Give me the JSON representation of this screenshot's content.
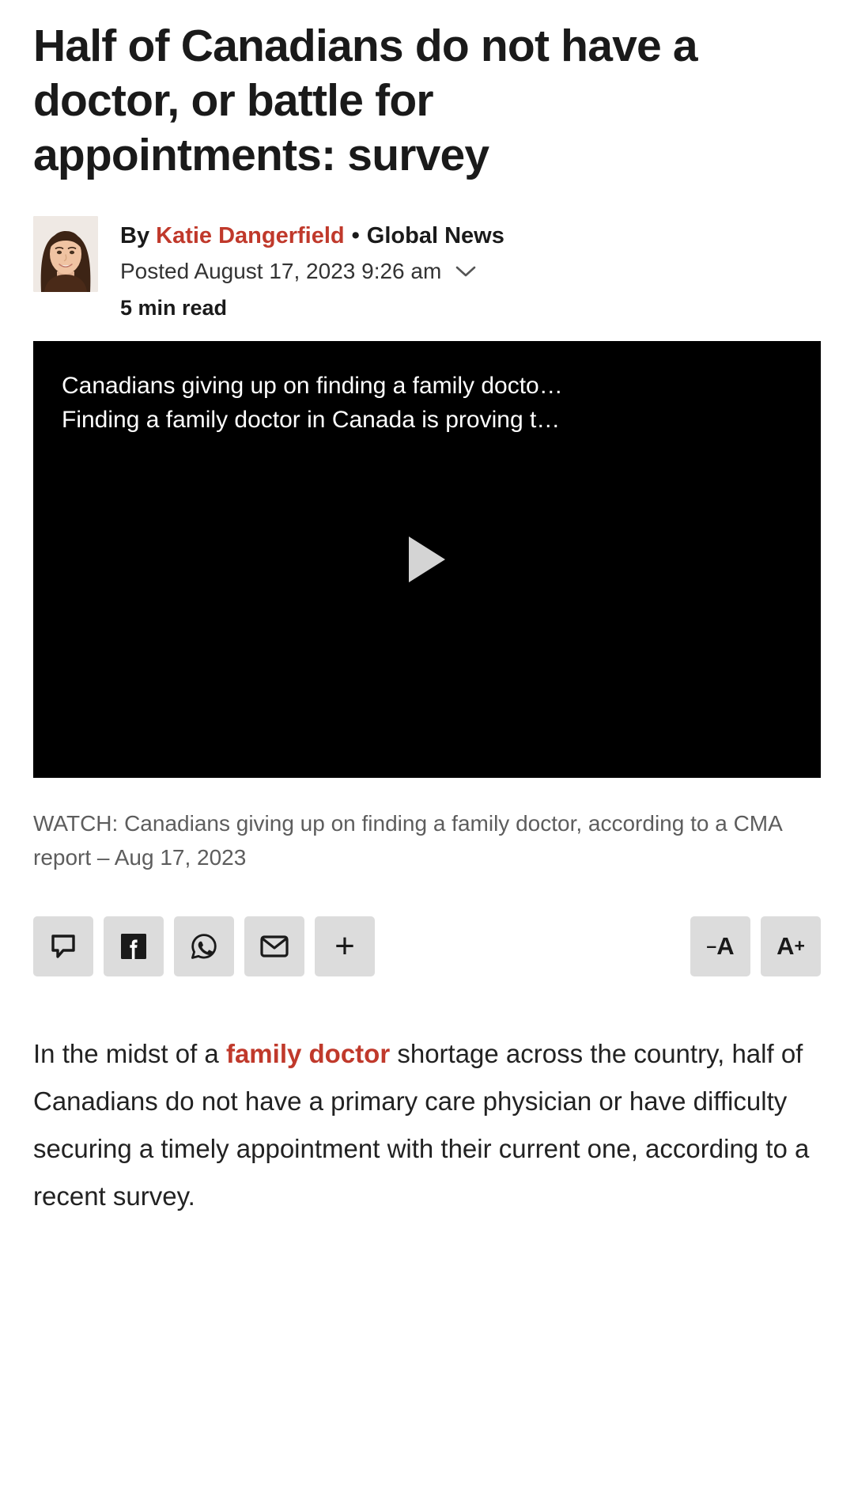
{
  "article": {
    "headline": "Half of Canadians do not have a doctor, or battle for appointments: survey",
    "byline": {
      "by_prefix": "By ",
      "author": "Katie Dangerfield",
      "separator": "•",
      "publication": "Global News",
      "posted": "Posted August 17, 2023 9:26 am",
      "read_time": "5 min read",
      "expand_icon": "chevron-down-icon",
      "avatar_alt": "Katie Dangerfield"
    },
    "video": {
      "title": "Canadians giving up on finding a family docto…",
      "subtitle": "Finding a family doctor in Canada is proving t…",
      "play_icon": "play-icon"
    },
    "caption": "WATCH: Canadians giving up on finding a family doctor, according to a CMA report – Aug 17, 2023",
    "share": {
      "buttons": [
        {
          "name": "comment-button",
          "icon": "comment-icon",
          "label": "Comments"
        },
        {
          "name": "facebook-share-button",
          "icon": "facebook-icon",
          "label": "Share on Facebook"
        },
        {
          "name": "whatsapp-share-button",
          "icon": "whatsapp-icon",
          "label": "Share on WhatsApp"
        },
        {
          "name": "email-share-button",
          "icon": "email-icon",
          "label": "Share by email"
        },
        {
          "name": "more-share-button",
          "icon": "plus-icon",
          "label": "+"
        }
      ],
      "text_size": {
        "decrease_minus": "–",
        "decrease_letter": "A",
        "increase_plus": "+",
        "increase_letter": "A"
      }
    },
    "body": {
      "p1_part1": "In the midst of a ",
      "p1_highlight": "family doctor",
      "p1_part2": " shortage across the country, half of Canadians do not have a primary care physician or have difficulty securing a timely appointment with their current one, according to a recent survey."
    }
  },
  "colors": {
    "accent": "#c0392b",
    "text": "#1a1a1a",
    "muted": "#5d5d5d",
    "button_bg": "#dcdcdc",
    "video_bg": "#000000"
  }
}
